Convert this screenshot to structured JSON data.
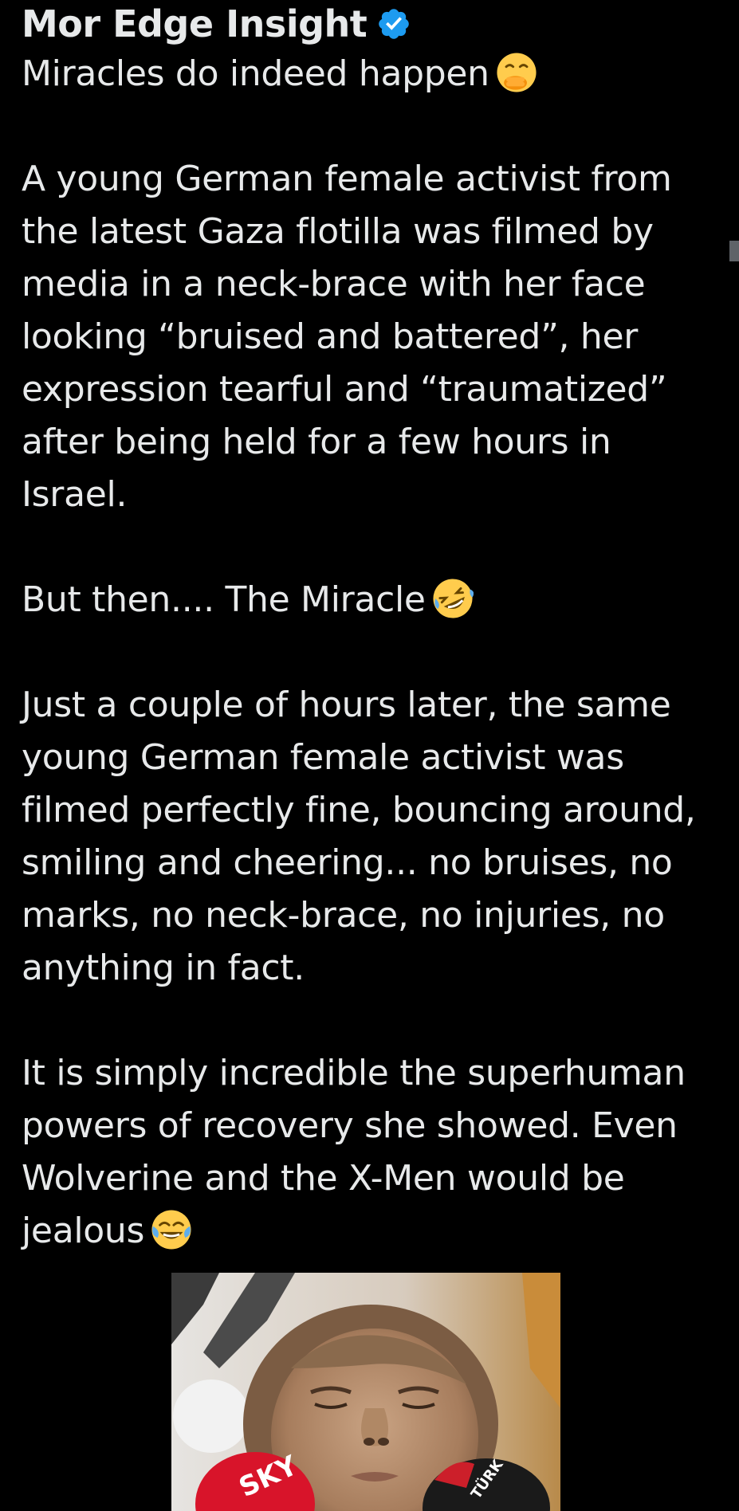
{
  "post": {
    "author_name": "Mor Edge Insight",
    "verified_icon": "verified-badge-icon",
    "colors": {
      "background": "#000000",
      "text": "#e7e9ea",
      "verified": "#1d9bf0"
    },
    "paragraphs": [
      {
        "text": "Miracles do indeed happen",
        "emoji": "hand-over-mouth-emoji"
      },
      {
        "text": "A young German female activist from the latest Gaza flotilla was filmed by media in a neck-brace with her face looking “bruised and battered”, her expression tearful and “traumatized” after being held for a few hours in Israel."
      },
      {
        "text": "But then.... The Miracle",
        "emoji": "rolling-on-floor-laughing-emoji"
      },
      {
        "text": "Just a couple of hours later, the same young German female activist was filmed perfectly fine, bouncing around, smiling and cheering... no bruises, no marks, no neck-brace, no injuries, no anything in fact."
      },
      {
        "text": "It is simply incredible the superhuman powers of recovery she showed. Even Wolverine and the X-Men would be jealous",
        "emoji": "face-with-tears-of-joy-emoji"
      }
    ],
    "media": {
      "type": "video-thumbnail",
      "icon": "video-thumbnail-image"
    }
  }
}
